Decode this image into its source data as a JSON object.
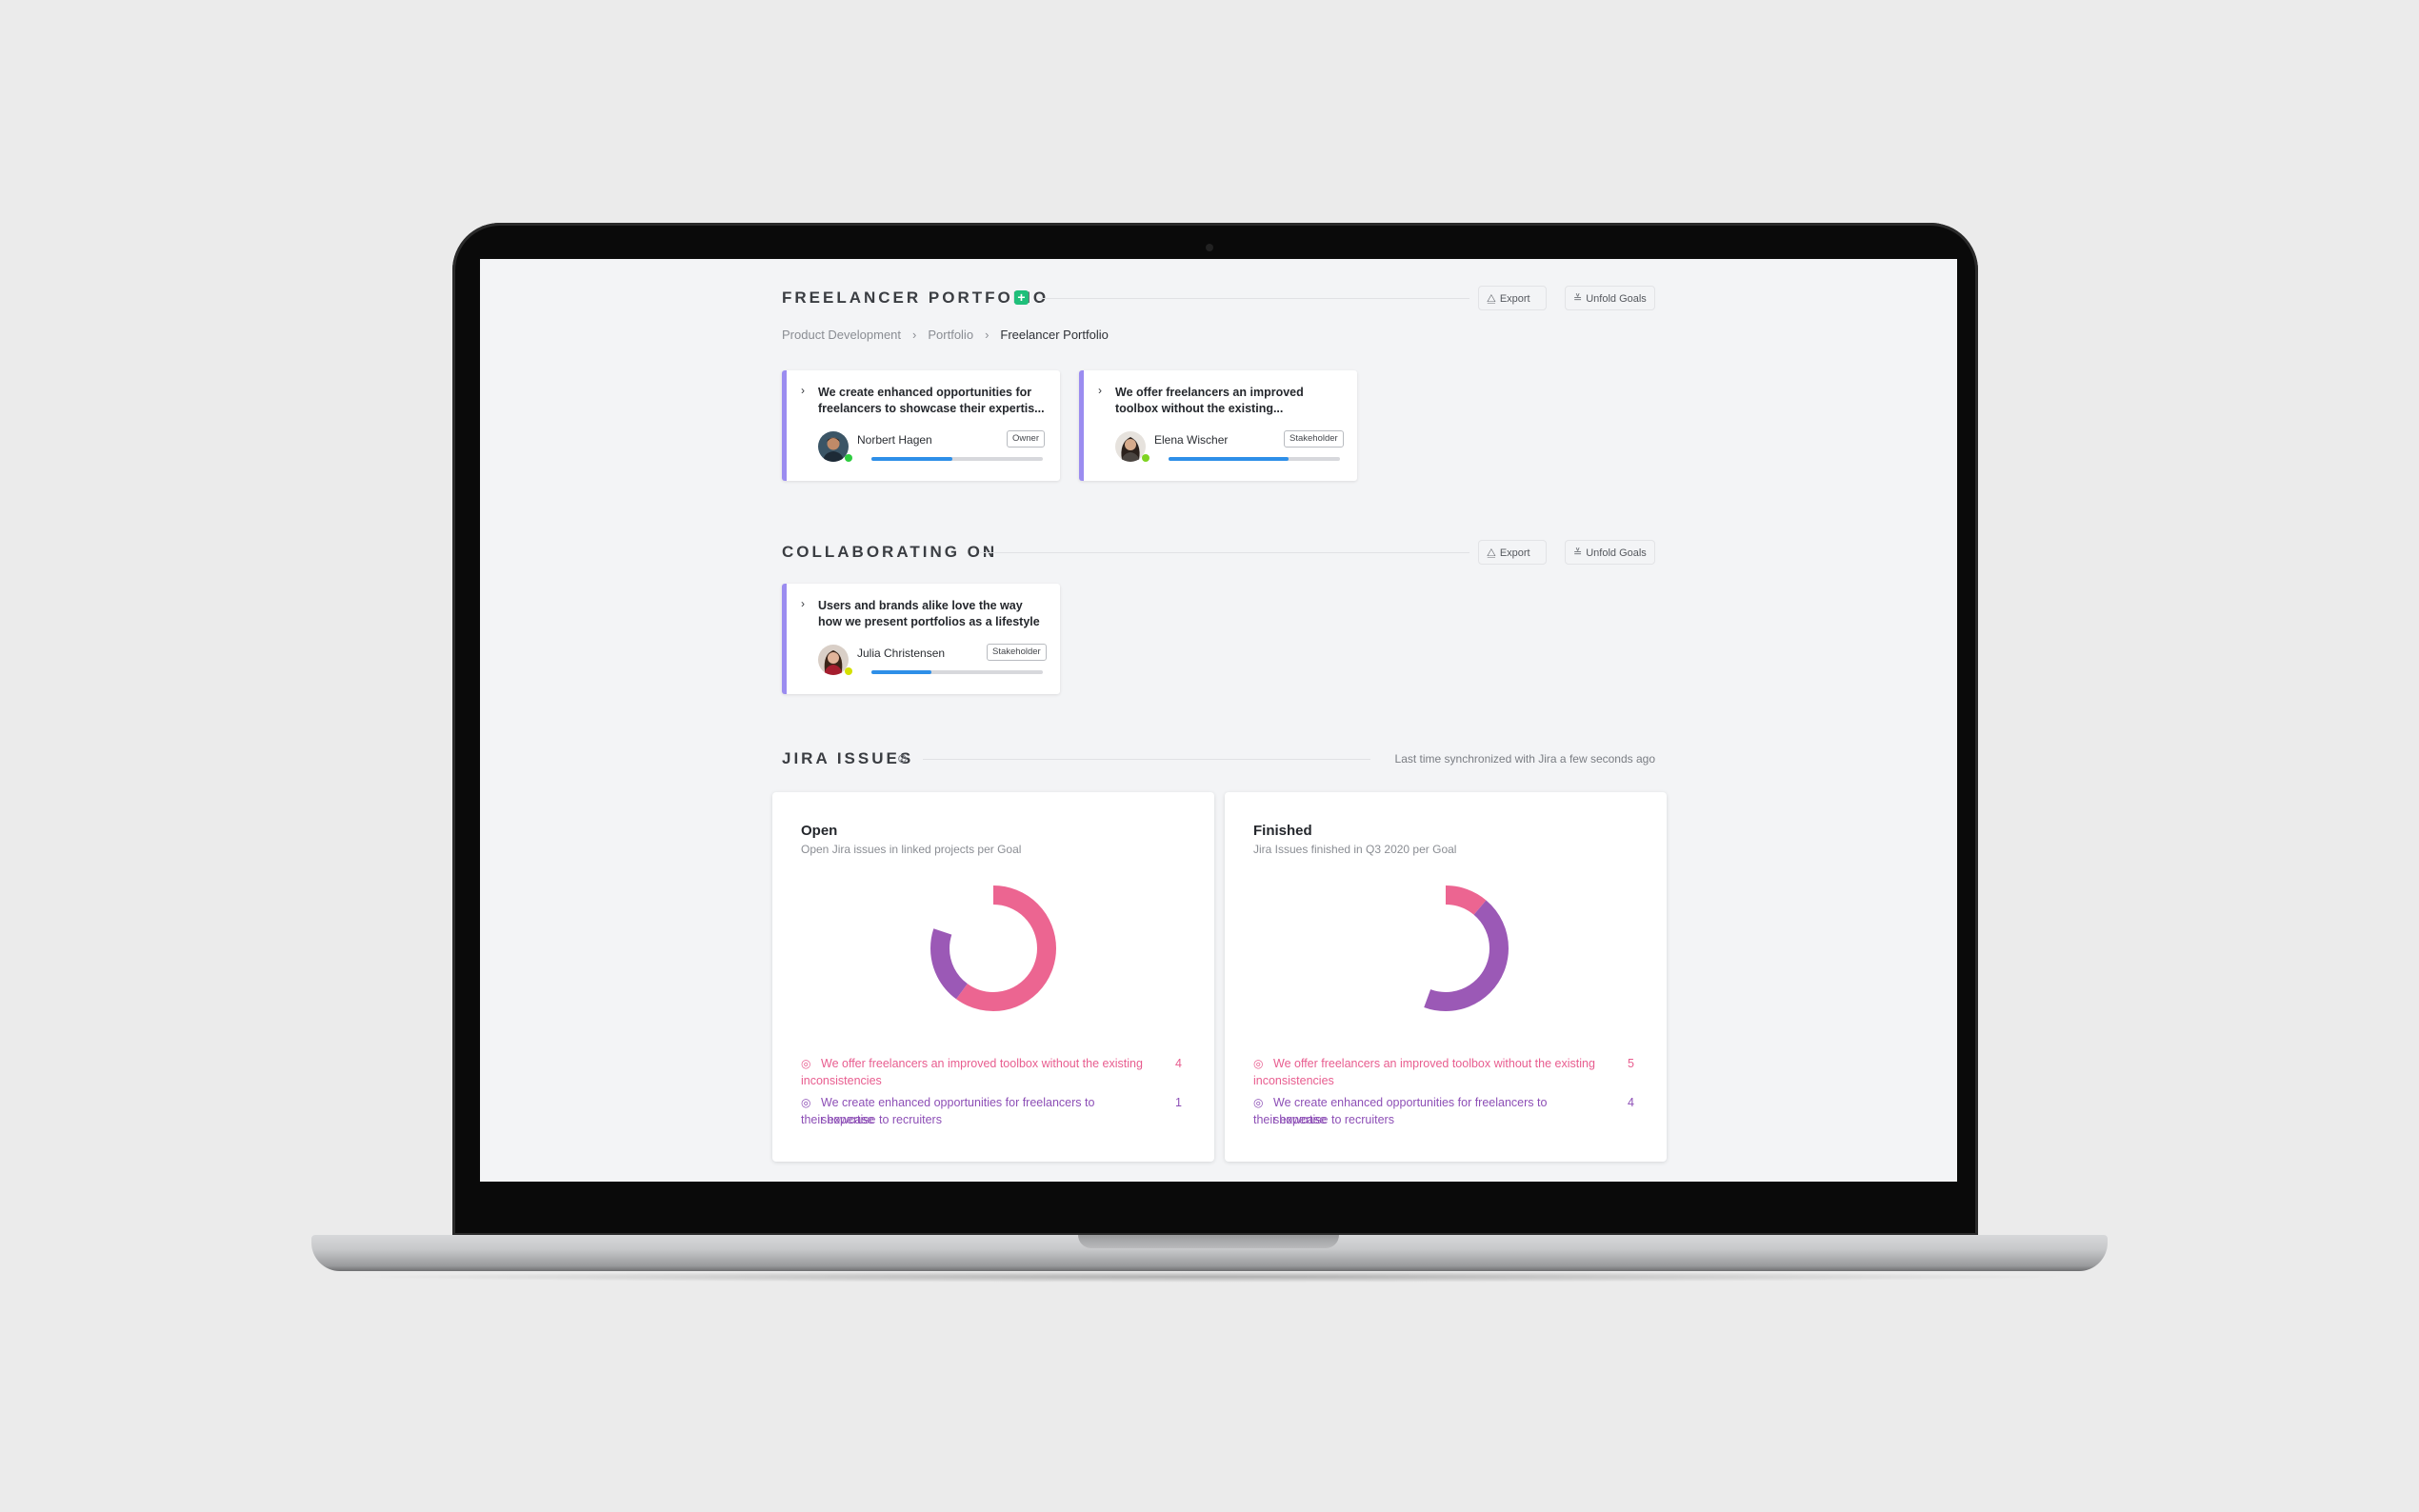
{
  "sections": {
    "portfolio": {
      "title": "FREELANCER PORTFOLIO",
      "export_label": "Export",
      "unfold_label": "Unfold Goals"
    },
    "collaborating": {
      "title": "COLLABORATING ON",
      "export_label": "Export",
      "unfold_label": "Unfold Goals"
    },
    "jira": {
      "title": "JIRA ISSUES",
      "sync_status": "Last time synchronized with Jira a few seconds ago"
    }
  },
  "breadcrumb": [
    "Product Development",
    "Portfolio",
    "Freelancer Portfolio"
  ],
  "portfolio_goals": [
    {
      "title_line1": "We create enhanced opportunities for",
      "title_line2": "freelancers to showcase their expertis...",
      "person": "Norbert Hagen",
      "role": "Owner",
      "progress": 0.47,
      "status_color": "#2ecc40"
    },
    {
      "title_line1": "We offer freelancers an improved",
      "title_line2": "toolbox without the existing...",
      "person": "Elena Wischer",
      "role": "Stakeholder",
      "progress": 0.7,
      "status_color": "#7ed321"
    }
  ],
  "collab_goals": [
    {
      "title_line1": "Users and brands alike love the way",
      "title_line2": "how we present portfolios as a lifestyle",
      "person": "Julia Christensen",
      "role": "Stakeholder",
      "progress": 0.35,
      "status_color": "#d4e000"
    }
  ],
  "jira_cards": [
    {
      "title": "Open",
      "subtitle": "Open Jira issues in linked projects per Goal",
      "legend": [
        {
          "line1": "We offer freelancers an improved toolbox without the existing",
          "line2": "inconsistencies",
          "value": "4"
        },
        {
          "line1": "We create enhanced opportunities for freelancers to showcase",
          "line2": "their expertise to recruiters",
          "value": "1"
        }
      ]
    },
    {
      "title": "Finished",
      "subtitle": "Jira Issues finished in Q3 2020 per Goal",
      "legend": [
        {
          "line1": "We offer freelancers an improved toolbox without the existing",
          "line2": "inconsistencies",
          "value": "5"
        },
        {
          "line1": "We create enhanced opportunities for freelancers to showcase",
          "line2": "their expertise to recruiters",
          "value": "4"
        }
      ]
    }
  ],
  "chart_data": [
    {
      "type": "pie",
      "title": "Open",
      "categories": [
        "We offer freelancers an improved toolbox without the existing inconsistencies",
        "We create enhanced opportunities for freelancers to showcase their expertise to recruiters"
      ],
      "values": [
        4,
        1
      ],
      "colors": [
        "#ec6591",
        "#9b59b6"
      ]
    },
    {
      "type": "pie",
      "title": "Finished",
      "categories": [
        "We offer freelancers an improved toolbox without the existing inconsistencies",
        "We create enhanced opportunities for freelancers to showcase their expertise to recruiters"
      ],
      "values": [
        5,
        4
      ],
      "colors": [
        "#ec6591",
        "#9b59b6"
      ]
    }
  ],
  "colors": {
    "accent_border": "#9b8cf0",
    "progress": "#2e8fe8",
    "add_button": "#1fbf7a"
  }
}
